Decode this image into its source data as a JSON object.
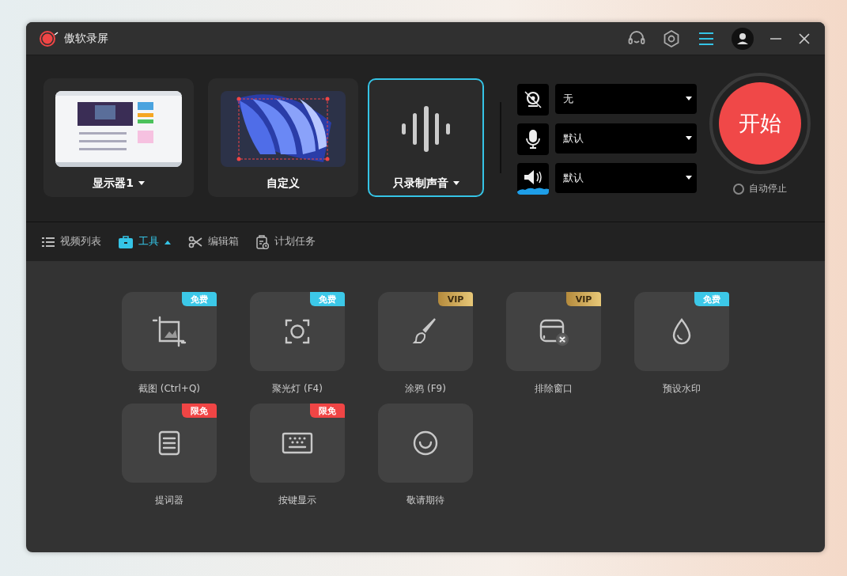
{
  "window": {
    "title": "傲软录屏"
  },
  "sources": [
    {
      "label": "显示器1",
      "has_menu": true,
      "selected": false
    },
    {
      "label": "自定义",
      "has_menu": false,
      "selected": false
    },
    {
      "label": "只录制声音",
      "has_menu": true,
      "selected": true
    }
  ],
  "devices": [
    {
      "kind": "camera",
      "value": "无"
    },
    {
      "kind": "microphone",
      "value": "默认"
    },
    {
      "kind": "speaker",
      "value": "默认"
    }
  ],
  "start_button": "开始",
  "auto_stop": {
    "label": "自动停止",
    "checked": false
  },
  "nav": [
    {
      "label": "视频列表",
      "selected": false
    },
    {
      "label": "工具",
      "selected": true
    },
    {
      "label": "编辑箱",
      "selected": false
    },
    {
      "label": "计划任务",
      "selected": false
    }
  ],
  "tools": [
    {
      "label": "截图 (Ctrl+Q)",
      "badge": "免费",
      "kind": "free"
    },
    {
      "label": "聚光灯 (F4)",
      "badge": "免费",
      "kind": "free"
    },
    {
      "label": "涂鸦 (F9)",
      "badge": "VIP",
      "kind": "vip"
    },
    {
      "label": "排除窗口",
      "badge": "VIP",
      "kind": "vip"
    },
    {
      "label": "预设水印",
      "badge": "免费",
      "kind": "free"
    },
    {
      "label": "提词器",
      "badge": "限免",
      "kind": "limited"
    },
    {
      "label": "按键显示",
      "badge": "限免",
      "kind": "limited"
    },
    {
      "label": "敬请期待"
    }
  ]
}
